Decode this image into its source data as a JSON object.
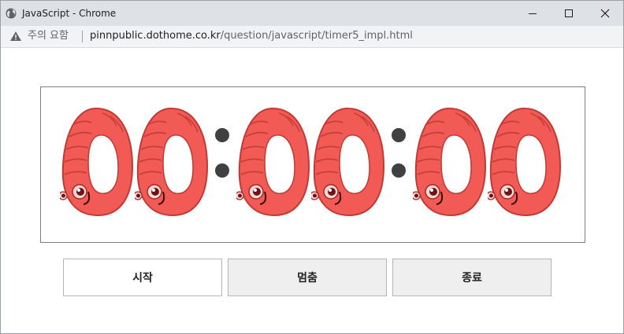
{
  "window": {
    "title": "JavaScript - Chrome",
    "controls": [
      "minimize",
      "maximize",
      "close"
    ]
  },
  "addressbar": {
    "security_label": "주의 요함",
    "url_host": "pinnpublic.dothome.co.kr",
    "url_path": "/question/javascript/timer5_impl.html"
  },
  "timer": {
    "digits": [
      "0",
      "0",
      "0",
      "0",
      "0",
      "0"
    ],
    "separator": ":",
    "digit_style": "shrimp-zero",
    "digit_color": "#f25a55",
    "separator_color": "#404040"
  },
  "buttons": {
    "start": "시작",
    "stop": "멈춤",
    "end": "종료"
  }
}
